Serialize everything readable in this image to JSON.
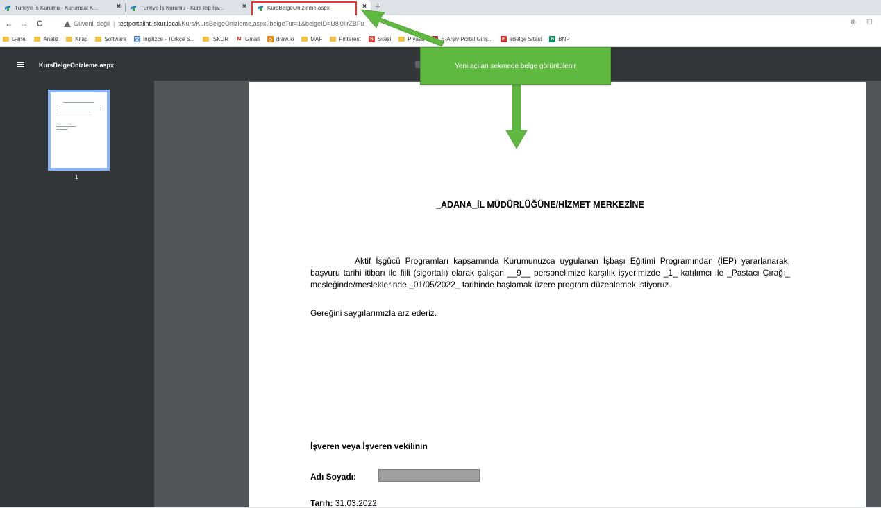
{
  "browser": {
    "tabs": [
      {
        "title": "Türkiye İş Kurumu - Kurumsal K..."
      },
      {
        "title": "Türkiye İş Kurumu - Kurs Iep İşv..."
      },
      {
        "title": "KursBelgeOnizleme.aspx"
      }
    ],
    "close_glyph": "×",
    "new_tab_glyph": "+",
    "nav": {
      "back": "←",
      "forward": "→",
      "reload": "C"
    },
    "security_label": "Güvenli değil",
    "url_host": "testportalint.iskur.local",
    "url_path": "/Kurs/KursBelgeOnizleme.aspx?belgeTur=1&belgeID=U8j0IlrZBFu",
    "toolbar_right": "⊕ ☐",
    "bookmarks": [
      {
        "label": "Genel",
        "icon": "folder-icon"
      },
      {
        "label": "Analiz",
        "icon": "folder-icon"
      },
      {
        "label": "Kitap",
        "icon": "folder-icon"
      },
      {
        "label": "Software",
        "icon": "folder-icon"
      },
      {
        "label": "İngilizce - Türkçe S...",
        "icon": "translate-icon"
      },
      {
        "label": "İŞKUR",
        "icon": "folder-icon"
      },
      {
        "label": "Gmail",
        "icon": "gmail-icon"
      },
      {
        "label": "draw.io",
        "icon": "drawio-icon"
      },
      {
        "label": "MAF",
        "icon": "folder-icon"
      },
      {
        "label": "Pinterest",
        "icon": "folder-icon"
      },
      {
        "label": "Sitesi",
        "icon": "site-icon"
      },
      {
        "label": "Piyasa",
        "icon": "folder-icon"
      },
      {
        "label": "E-Arşiv Portal Giriş...",
        "icon": "earsiv-icon"
      },
      {
        "label": "eBelge Sitesi",
        "icon": "ebelge-icon"
      },
      {
        "label": "BNP",
        "icon": "bnp-icon"
      }
    ]
  },
  "viewer": {
    "document_title": "KursBelgeOnizleme.aspx",
    "page_number": "1"
  },
  "document": {
    "heading_main": "_ADANA_İL MÜDÜRLÜĞÜNE/",
    "heading_struck": "HİZMET MERKEZİNE",
    "paragraph_before_strike": "Aktif İşgücü Programları kapsamında Kurumunuzca uygulanan İşbaşı Eğitimi Programından (İEP) yararlanarak, başvuru tarihi itibarı ile fiili (sigortalı) olarak çalışan __9__ personelimize karşılık işyerimizde _1_ katılımcı ile _Pastacı Çırağı_ mesleğinde/",
    "paragraph_struck": "mesleklerind",
    "paragraph_after_strike": "e _01/05/2022_ tarihinde başlamak üzere program düzenlemek istiyoruz.",
    "closing": "Gereğini saygılarımızla arz ederiz.",
    "employer_label": "İşveren veya İşveren vekilinin",
    "name_label": "Adı Soyadı:",
    "date_label": "Tarih:",
    "date_value": "31.03.2022"
  },
  "annotation": {
    "callout_text": "Yeni açılan sekmede belge görüntülenir",
    "color": "#5fb840",
    "highlight_color": "#e8362f"
  }
}
